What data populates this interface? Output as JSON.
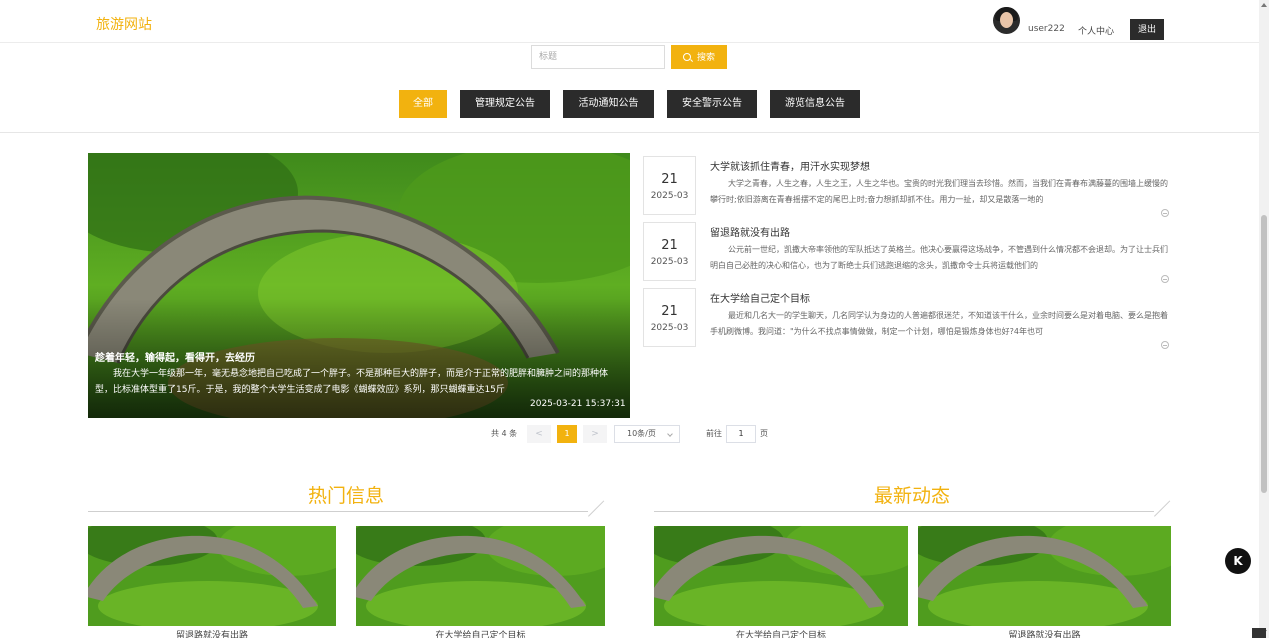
{
  "header": {
    "logo": "旅游网站",
    "username": "user222",
    "profile_link": "个人中心",
    "logout_label": "退出"
  },
  "search": {
    "placeholder": "标题",
    "button_label": "搜索"
  },
  "tabs": [
    {
      "label": "全部",
      "active": true
    },
    {
      "label": "管理规定公告",
      "active": false
    },
    {
      "label": "活动通知公告",
      "active": false
    },
    {
      "label": "安全警示公告",
      "active": false
    },
    {
      "label": "游览信息公告",
      "active": false
    }
  ],
  "banner": {
    "title": "趁着年轻，输得起，看得开，去经历",
    "text": "我在大学一年级那一年，毫无悬念地把自己吃成了一个胖子。不是那种巨大的胖子，而是介于正常的肥胖和臃肿之间的那种体型，比标准体型重了15斤。于是，我的整个大学生活变成了电影《蝴蝶效应》系列，那只蝴蝶重达15斤",
    "time": "2025-03-21 15:37:31"
  },
  "news": [
    {
      "day": "21",
      "ym": "2025-03",
      "title": "大学就该抓住青春，用汗水实现梦想",
      "text": "大学之青春，人生之春，人生之王，人生之华也。宝贵的时光我们理当去珍惜。然而，当我们在青春布满藤蔓的围墙上缓慢的攀行时;依旧游离在青春摇摆不定的尾巴上时;奋力想抓却抓不住。用力一扯，却又是散落一地的"
    },
    {
      "day": "21",
      "ym": "2025-03",
      "title": "留退路就没有出路",
      "text": "公元前一世纪，凯撒大帝率领他的军队抵达了英格兰。他决心要赢得这场战争，不管遇到什么情况都不会退却。为了让士兵们明白自己必胜的决心和信心，也为了断绝士兵们逃跑退缩的念头，凯撒命令士兵将运载他们的"
    },
    {
      "day": "21",
      "ym": "2025-03",
      "title": "在大学给自己定个目标",
      "text": "最近和几名大一的学生聊天，几名同学认为身边的人普遍都很迷茫，不知道该干什么，业余时间要么是对着电脑、要么是抱着手机刷微博。我问道：\"为什么不找点事情做做，制定一个计划，哪怕是锻炼身体也好?4年也可"
    }
  ],
  "pagination": {
    "total": "共 4 条",
    "prev": "<",
    "current": "1",
    "next": ">",
    "page_size": "10条/页",
    "goto_label": "前往",
    "goto_value": "1",
    "page_suffix": "页"
  },
  "sections": {
    "hot": {
      "title": "热门信息",
      "items": [
        "留退路就没有出路",
        "在大学给自己定个目标"
      ]
    },
    "latest": {
      "title": "最新动态",
      "items": [
        "在大学给自己定个目标",
        "留退路就没有出路"
      ]
    }
  },
  "colors": {
    "accent": "#f2b20f",
    "dark": "#2b2b2b"
  },
  "icons": {
    "search": "search-icon",
    "more": "arrow-circle-icon",
    "floating": "k-logo-icon"
  },
  "floating_button": "K"
}
